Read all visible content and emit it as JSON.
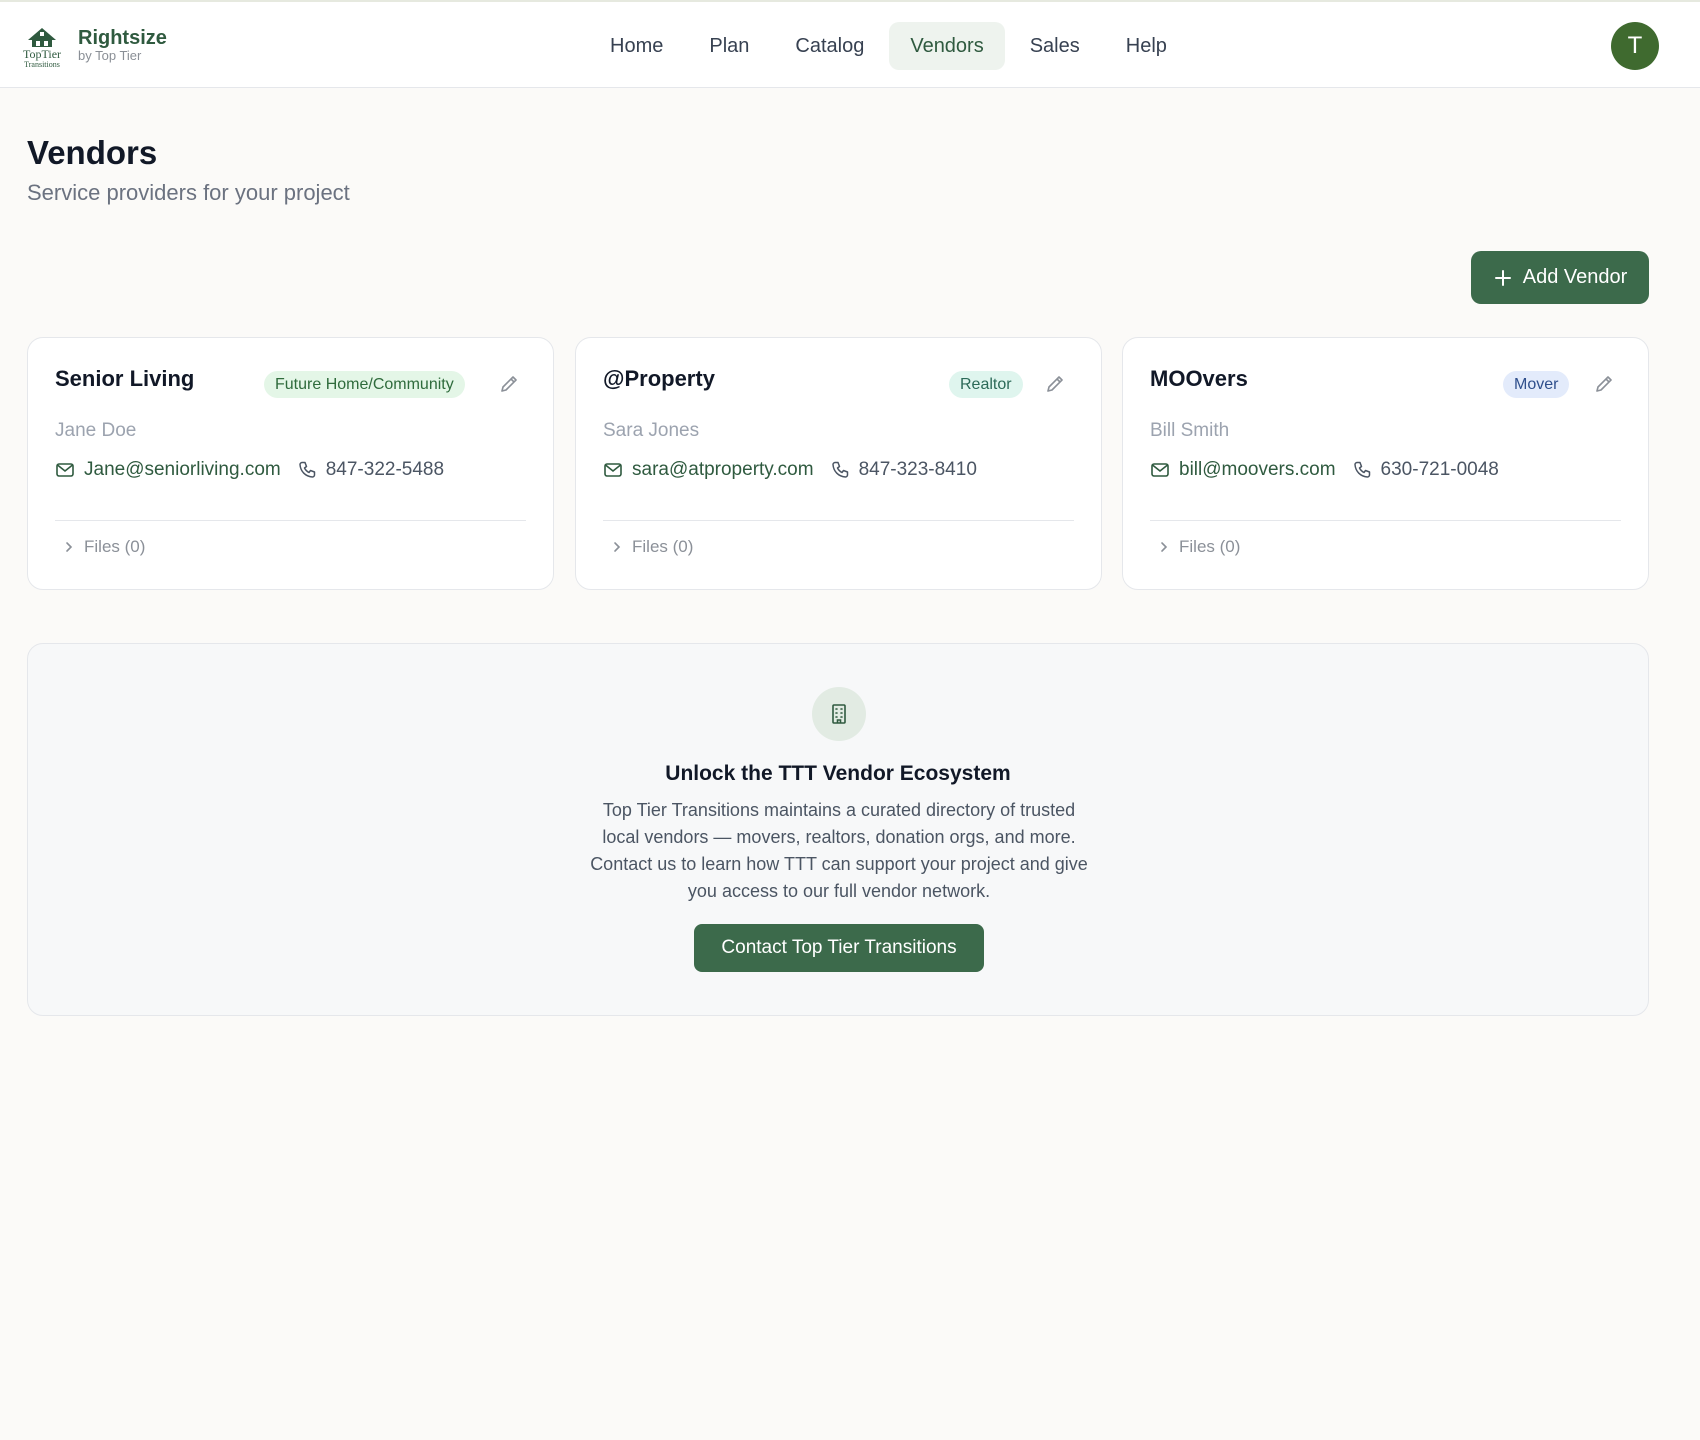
{
  "brand": {
    "name": "Rightsize",
    "sub": "by Top Tier",
    "logo_text_1": "TopTier",
    "logo_text_2": "Transitions"
  },
  "nav": [
    {
      "label": "Home",
      "active": false
    },
    {
      "label": "Plan",
      "active": false
    },
    {
      "label": "Catalog",
      "active": false
    },
    {
      "label": "Vendors",
      "active": true
    },
    {
      "label": "Sales",
      "active": false
    },
    {
      "label": "Help",
      "active": false
    }
  ],
  "user": {
    "initial": "T"
  },
  "page": {
    "title": "Vendors",
    "subtitle": "Service providers for your project"
  },
  "actions": {
    "add_vendor": "Add Vendor"
  },
  "vendors": [
    {
      "name": "Senior Living",
      "category": "Future Home/Community",
      "badge_bg": "#e4f6e7",
      "badge_fg": "#2f6b3c",
      "contact": "Jane Doe",
      "email": "Jane@seniorliving.com",
      "phone": "847-322-5488",
      "files": "Files (0)"
    },
    {
      "name": "@Property",
      "category": "Realtor",
      "badge_bg": "#dff5ee",
      "badge_fg": "#2c6a58",
      "contact": "Sara Jones",
      "email": "sara@atproperty.com",
      "phone": "847-323-8410",
      "files": "Files (0)"
    },
    {
      "name": "MOOvers",
      "category": "Mover",
      "badge_bg": "#e3ebfb",
      "badge_fg": "#2f4f8c",
      "contact": "Bill Smith",
      "email": "bill@moovers.com",
      "phone": "630-721-0048",
      "files": "Files (0)"
    }
  ],
  "promo": {
    "title": "Unlock the TTT Vendor Ecosystem",
    "body": "Top Tier Transitions maintains a curated directory of trusted local vendors — movers, realtors, donation orgs, and more. Contact us to learn how TTT can support your project and give you access to our full vendor network.",
    "button": "Contact Top Tier Transitions"
  },
  "colors": {
    "accent": "#3c6a4b",
    "avatar": "#3f6a2f"
  }
}
